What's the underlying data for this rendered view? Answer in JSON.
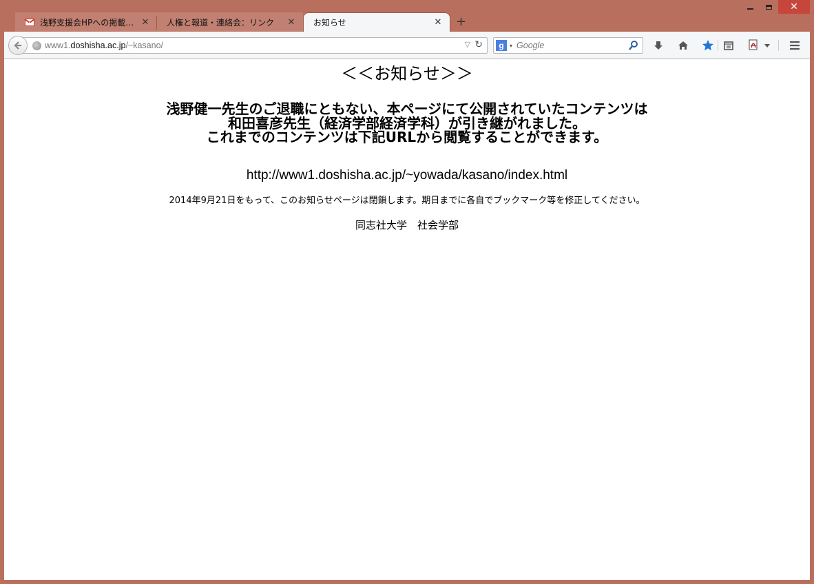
{
  "window": {
    "controls": {
      "minimize": "–",
      "maximize": "□",
      "close": "✕"
    }
  },
  "tabs": [
    {
      "label": "浅野支援会HPへの掲載お…",
      "icon": "gmail-icon",
      "active": false
    },
    {
      "label": "人権と報道・連絡会：リンク",
      "icon": "",
      "active": false
    },
    {
      "label": "お知らせ",
      "icon": "",
      "active": true
    }
  ],
  "tab_close_glyph": "✕",
  "new_tab_glyph": "+",
  "navbar": {
    "url_prefix": "www1.",
    "url_host": "doshisha.ac.jp",
    "url_path": "/~kasano/",
    "search_engine_letter": "g",
    "search_placeholder": "Google"
  },
  "content": {
    "title": "＜＜お知らせ＞＞",
    "main_lines": [
      "浅野健一先生のご退職にともない、本ページにて公開されていたコンテンツは",
      "和田喜彦先生（経済学部経済学科）が引き継がれました。",
      "これまでのコンテンツは下記URLから閲覧することができます。"
    ],
    "url": "http://www1.doshisha.ac.jp/~yowada/kasano/index.html",
    "closing_notice": "2014年9月21日をもって、このお知らせページは閉鎖します。期日までに各自でブックマーク等を修正してください。",
    "organization": "同志社大学　社会学部"
  },
  "colors": {
    "window_frame": "#b96f5e",
    "close_button": "#c7463c",
    "toolbar": "#f5f6f7",
    "bookmark_star": "#1e78d6"
  }
}
